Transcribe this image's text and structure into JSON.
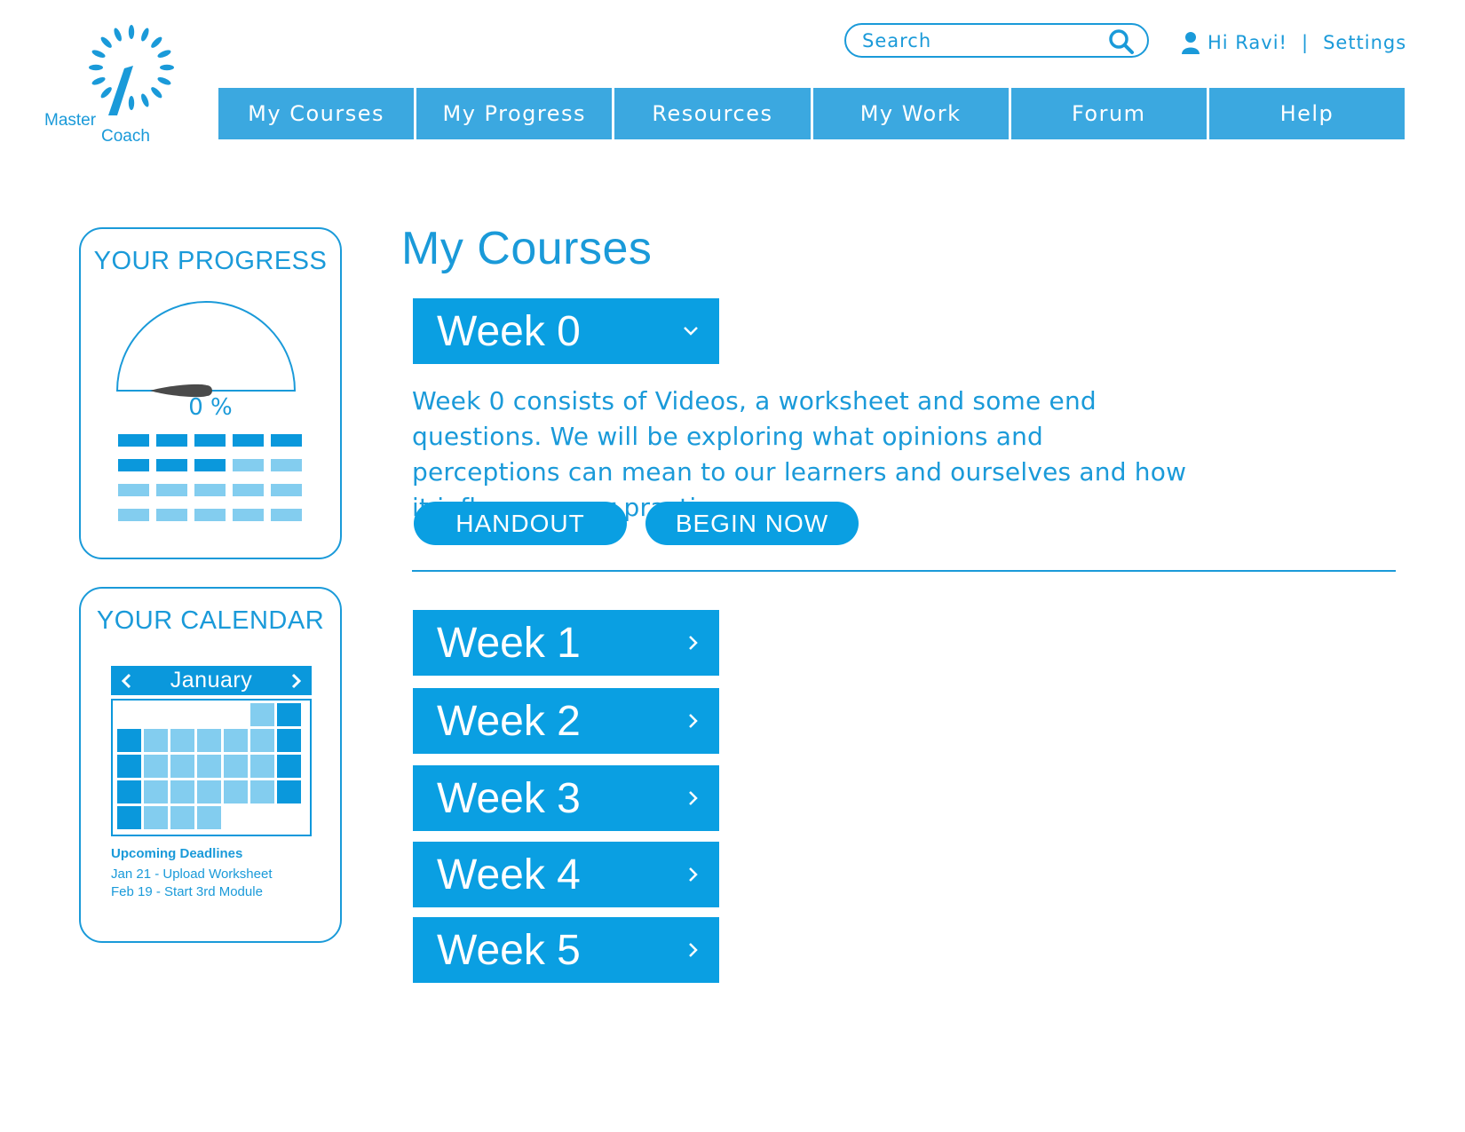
{
  "logo": {
    "line1": "Master",
    "line2": "Coach"
  },
  "search": {
    "placeholder": "Search"
  },
  "user": {
    "greeting": "Hi Ravi!",
    "separator": "|",
    "settings": "Settings"
  },
  "nav": {
    "items": [
      {
        "label": "My Courses"
      },
      {
        "label": "My Progress"
      },
      {
        "label": "Resources"
      },
      {
        "label": "My Work"
      },
      {
        "label": "Forum"
      },
      {
        "label": "Help"
      }
    ]
  },
  "progress": {
    "title": "YOUR PROGRESS",
    "percent_label": "0 %",
    "value": 0,
    "grid_rows": [
      [
        "dark",
        "dark",
        "dark",
        "dark",
        "dark"
      ],
      [
        "dark",
        "dark",
        "dark",
        "light",
        "light"
      ],
      [
        "light",
        "light",
        "light",
        "light",
        "light"
      ],
      [
        "light",
        "light",
        "light",
        "light",
        "light"
      ]
    ]
  },
  "calendar": {
    "title": "YOUR CALENDAR",
    "month": "January",
    "grid": [
      [
        "empty",
        "empty",
        "empty",
        "empty",
        "empty",
        "light",
        "dark"
      ],
      [
        "dark",
        "light",
        "light",
        "light",
        "light",
        "light",
        "dark"
      ],
      [
        "dark",
        "light",
        "light",
        "light",
        "light",
        "light",
        "dark"
      ],
      [
        "dark",
        "light",
        "light",
        "light",
        "light",
        "light",
        "dark"
      ],
      [
        "dark",
        "light",
        "light",
        "light",
        "empty",
        "empty",
        "empty"
      ]
    ],
    "deadlines_title": "Upcoming Deadlines",
    "deadlines": [
      "Jan 21 - Upload Worksheet",
      "Feb 19 - Start 3rd Module"
    ]
  },
  "main": {
    "title": "My Courses",
    "week0": {
      "label": "Week 0",
      "description": "Week 0 consists of Videos, a worksheet and some end questions. We will be exploring what opinions and perceptions can mean to our learners and ourselves and how it influences our practice.",
      "handout": "HANDOUT",
      "begin": "BEGIN NOW"
    },
    "weeks": [
      {
        "label": "Week 1"
      },
      {
        "label": "Week 2"
      },
      {
        "label": "Week 3"
      },
      {
        "label": "Week 4"
      },
      {
        "label": "Week 5"
      }
    ]
  },
  "colors": {
    "primary": "#0a9fe2",
    "nav": "#3ba8e0",
    "text": "#1a9ad9",
    "light_cell": "#83cdef",
    "needle": "#4a4a4a"
  }
}
